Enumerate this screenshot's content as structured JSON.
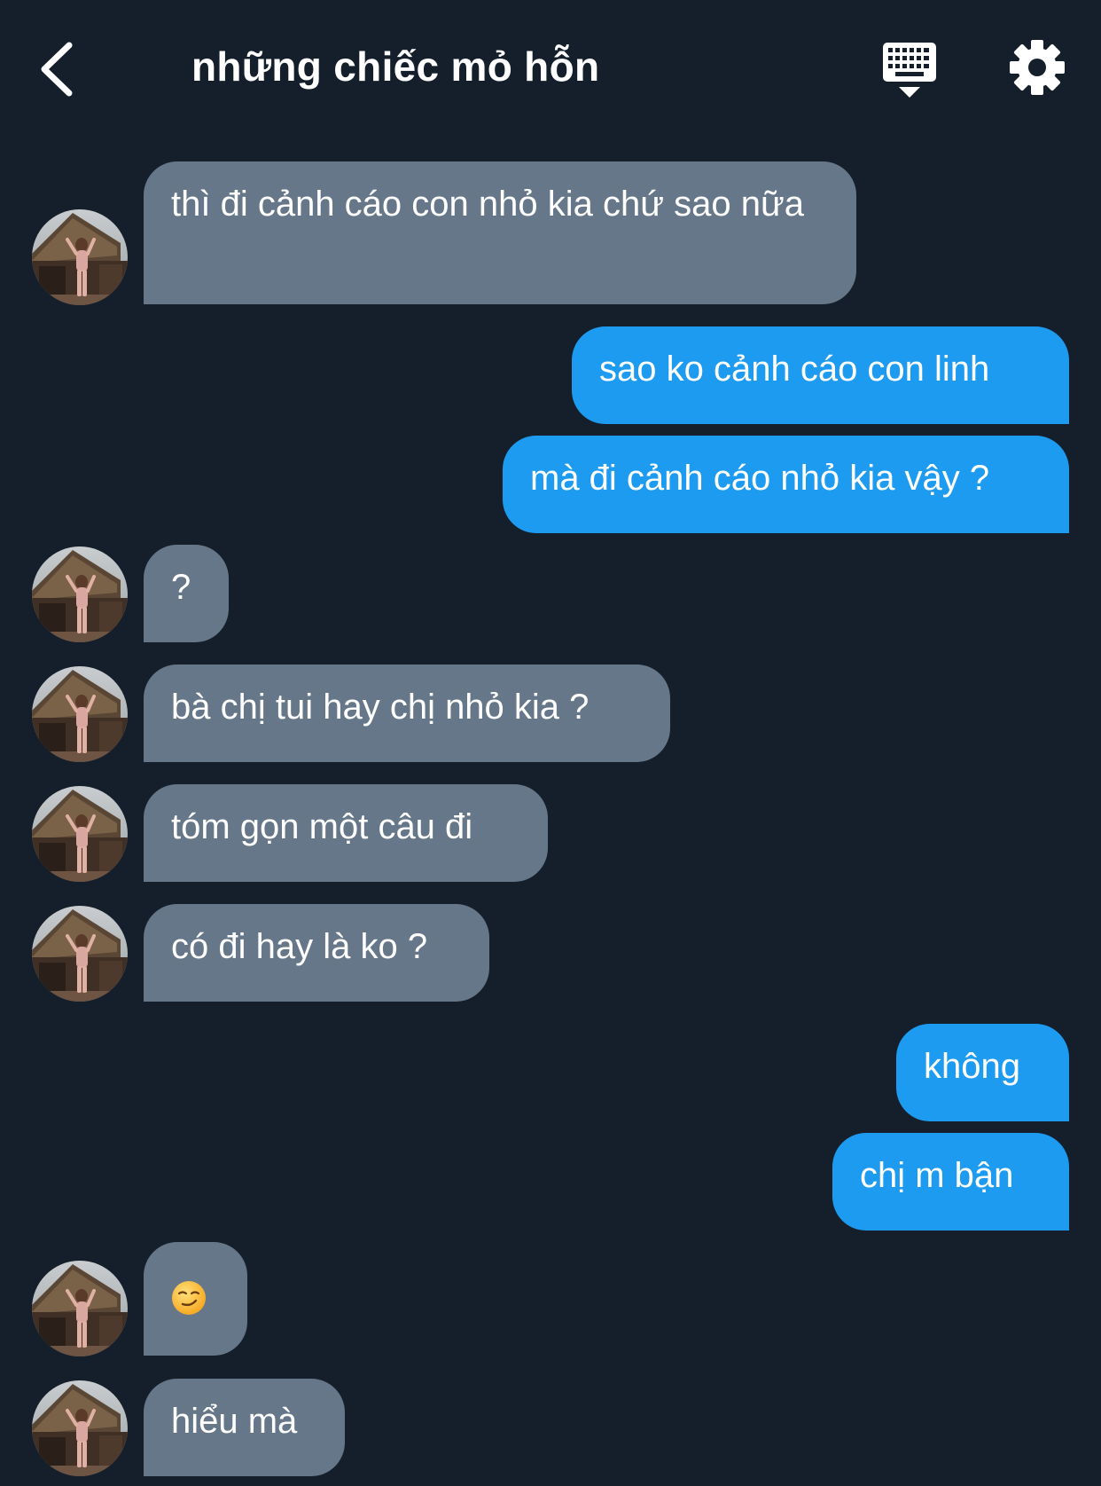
{
  "header": {
    "title": "những chiếc mỏ hỗn"
  },
  "messages": [
    {
      "dir": "in",
      "text": "thì đi cảnh cáo con nhỏ kia chứ sao nữa"
    },
    {
      "dir": "out",
      "text": "sao ko cảnh cáo con linh"
    },
    {
      "dir": "out",
      "text": "mà đi cảnh cáo nhỏ kia vậy ?"
    },
    {
      "dir": "in",
      "text": "?"
    },
    {
      "dir": "in",
      "text": "bà chị tui hay chị nhỏ kia ?"
    },
    {
      "dir": "in",
      "text": "tóm gọn một câu đi"
    },
    {
      "dir": "in",
      "text": "có đi hay là ko ?"
    },
    {
      "dir": "out",
      "text": "không"
    },
    {
      "dir": "out",
      "text": "chị m bận"
    },
    {
      "dir": "in",
      "emoji": "smirking-face"
    },
    {
      "dir": "in",
      "text": "hiểu mà"
    }
  ],
  "colors": {
    "background": "#151f2b",
    "incoming_bubble": "#667789",
    "outgoing_bubble": "#1d9bf0",
    "text": "#ffffff"
  }
}
